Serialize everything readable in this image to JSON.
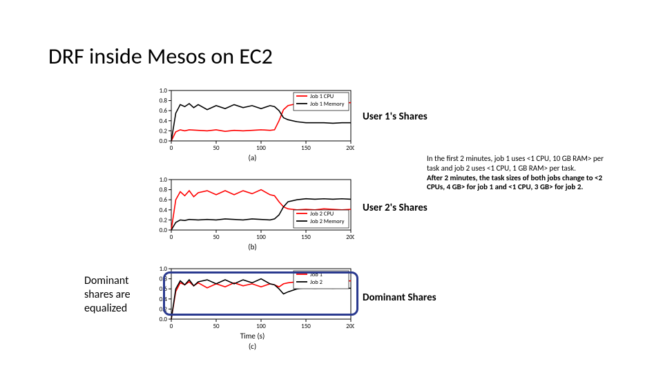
{
  "title": "DRF inside Mesos on EC2",
  "left_note": "Dominant shares are equalized",
  "side_labels": {
    "a": "User 1's Shares",
    "b": "User 2's Shares",
    "c": "Dominant Shares"
  },
  "desc_normal": "In the first 2 minutes, job 1 uses <1 CPU, 10 GB RAM> per task and job 2 uses <1 CPU, 1 GB RAM> per task.",
  "desc_bold": "After 2 minutes, the task sizes of both jobs change to <2 CPUs, 4 GB> for job 1 and <1 CPU, 3 GB> for job 2.",
  "xlabel": "Time (s)",
  "sub_a": "(a)",
  "sub_b": "(b)",
  "sub_c": "(c)",
  "chart_data": [
    {
      "type": "line",
      "title": "User 1's Shares",
      "xlabel": "Time (s)",
      "ylabel": "",
      "xlim": [
        0,
        200
      ],
      "ylim": [
        0.0,
        1.0
      ],
      "x_ticks": [
        0,
        50,
        100,
        150,
        200
      ],
      "y_ticks": [
        0.0,
        0.2,
        0.4,
        0.6,
        0.8,
        1.0
      ],
      "legend": [
        "Job 1 CPU",
        "Job 1 Memory"
      ],
      "legend_colors": [
        "#ff0000",
        "#000000"
      ],
      "series": [
        {
          "name": "Job 1 CPU",
          "color": "#ff0000",
          "x": [
            0,
            5,
            10,
            15,
            20,
            30,
            40,
            50,
            60,
            70,
            80,
            90,
            100,
            110,
            115,
            120,
            125,
            130,
            140,
            150,
            160,
            170,
            180,
            190,
            200
          ],
          "y": [
            0.0,
            0.18,
            0.22,
            0.2,
            0.22,
            0.21,
            0.2,
            0.22,
            0.19,
            0.21,
            0.2,
            0.21,
            0.22,
            0.21,
            0.22,
            0.4,
            0.62,
            0.7,
            0.74,
            0.76,
            0.74,
            0.75,
            0.76,
            0.75,
            0.76
          ]
        },
        {
          "name": "Job 1 Memory",
          "color": "#000000",
          "x": [
            0,
            5,
            10,
            15,
            20,
            25,
            30,
            40,
            50,
            60,
            70,
            80,
            90,
            100,
            110,
            115,
            120,
            125,
            130,
            140,
            150,
            160,
            170,
            180,
            190,
            200
          ],
          "y": [
            0.0,
            0.55,
            0.72,
            0.68,
            0.74,
            0.66,
            0.72,
            0.62,
            0.7,
            0.64,
            0.72,
            0.66,
            0.7,
            0.64,
            0.7,
            0.68,
            0.6,
            0.46,
            0.42,
            0.38,
            0.36,
            0.36,
            0.36,
            0.35,
            0.36,
            0.36
          ]
        }
      ]
    },
    {
      "type": "line",
      "title": "User 2's Shares",
      "xlabel": "Time (s)",
      "ylabel": "",
      "xlim": [
        0,
        200
      ],
      "ylim": [
        0.0,
        1.0
      ],
      "x_ticks": [
        0,
        50,
        100,
        150,
        200
      ],
      "y_ticks": [
        0.0,
        0.2,
        0.4,
        0.6,
        0.8,
        1.0
      ],
      "legend": [
        "Job 2 CPU",
        "Job 2 Memory"
      ],
      "legend_colors": [
        "#ff0000",
        "#000000"
      ],
      "series": [
        {
          "name": "Job 2 CPU",
          "color": "#ff0000",
          "x": [
            0,
            5,
            10,
            15,
            20,
            25,
            30,
            40,
            50,
            60,
            70,
            80,
            90,
            100,
            110,
            115,
            120,
            125,
            130,
            140,
            150,
            160,
            170,
            180,
            190,
            200
          ],
          "y": [
            0.0,
            0.6,
            0.76,
            0.68,
            0.78,
            0.66,
            0.74,
            0.78,
            0.7,
            0.78,
            0.7,
            0.78,
            0.72,
            0.8,
            0.7,
            0.68,
            0.56,
            0.46,
            0.42,
            0.4,
            0.41,
            0.4,
            0.42,
            0.41,
            0.4,
            0.41
          ]
        },
        {
          "name": "Job 2 Memory",
          "color": "#000000",
          "x": [
            0,
            5,
            10,
            15,
            20,
            30,
            40,
            50,
            60,
            70,
            80,
            90,
            100,
            110,
            115,
            120,
            125,
            130,
            140,
            150,
            160,
            170,
            180,
            190,
            200
          ],
          "y": [
            0.0,
            0.15,
            0.2,
            0.19,
            0.21,
            0.2,
            0.21,
            0.2,
            0.22,
            0.21,
            0.2,
            0.22,
            0.21,
            0.2,
            0.22,
            0.3,
            0.46,
            0.56,
            0.6,
            0.62,
            0.61,
            0.62,
            0.61,
            0.62,
            0.61
          ]
        }
      ]
    },
    {
      "type": "line",
      "title": "Dominant Shares",
      "xlabel": "Time (s)",
      "ylabel": "",
      "xlim": [
        0,
        200
      ],
      "ylim": [
        0.0,
        1.0
      ],
      "x_ticks": [
        0,
        50,
        100,
        150,
        200
      ],
      "y_ticks": [
        0.0,
        0.2,
        0.4,
        0.6,
        0.8,
        1.0
      ],
      "legend": [
        "Job 1",
        "Job 2"
      ],
      "legend_colors": [
        "#ff0000",
        "#000000"
      ],
      "series": [
        {
          "name": "Job 1",
          "color": "#ff0000",
          "x": [
            0,
            5,
            10,
            15,
            20,
            25,
            30,
            40,
            50,
            60,
            70,
            80,
            90,
            100,
            110,
            115,
            120,
            125,
            130,
            140,
            150,
            160,
            170,
            180,
            190,
            200
          ],
          "y": [
            0.0,
            0.55,
            0.72,
            0.68,
            0.74,
            0.66,
            0.72,
            0.62,
            0.7,
            0.64,
            0.72,
            0.66,
            0.7,
            0.64,
            0.7,
            0.68,
            0.64,
            0.7,
            0.72,
            0.74,
            0.76,
            0.74,
            0.75,
            0.76,
            0.75,
            0.76
          ]
        },
        {
          "name": "Job 2",
          "color": "#000000",
          "x": [
            0,
            5,
            10,
            15,
            20,
            25,
            30,
            40,
            50,
            60,
            70,
            80,
            90,
            100,
            110,
            115,
            120,
            125,
            130,
            140,
            150,
            160,
            170,
            180,
            190,
            200
          ],
          "y": [
            0.0,
            0.6,
            0.76,
            0.68,
            0.78,
            0.66,
            0.74,
            0.78,
            0.7,
            0.78,
            0.7,
            0.78,
            0.72,
            0.8,
            0.7,
            0.68,
            0.6,
            0.5,
            0.54,
            0.6,
            0.62,
            0.61,
            0.62,
            0.61,
            0.62,
            0.61
          ]
        }
      ]
    }
  ]
}
